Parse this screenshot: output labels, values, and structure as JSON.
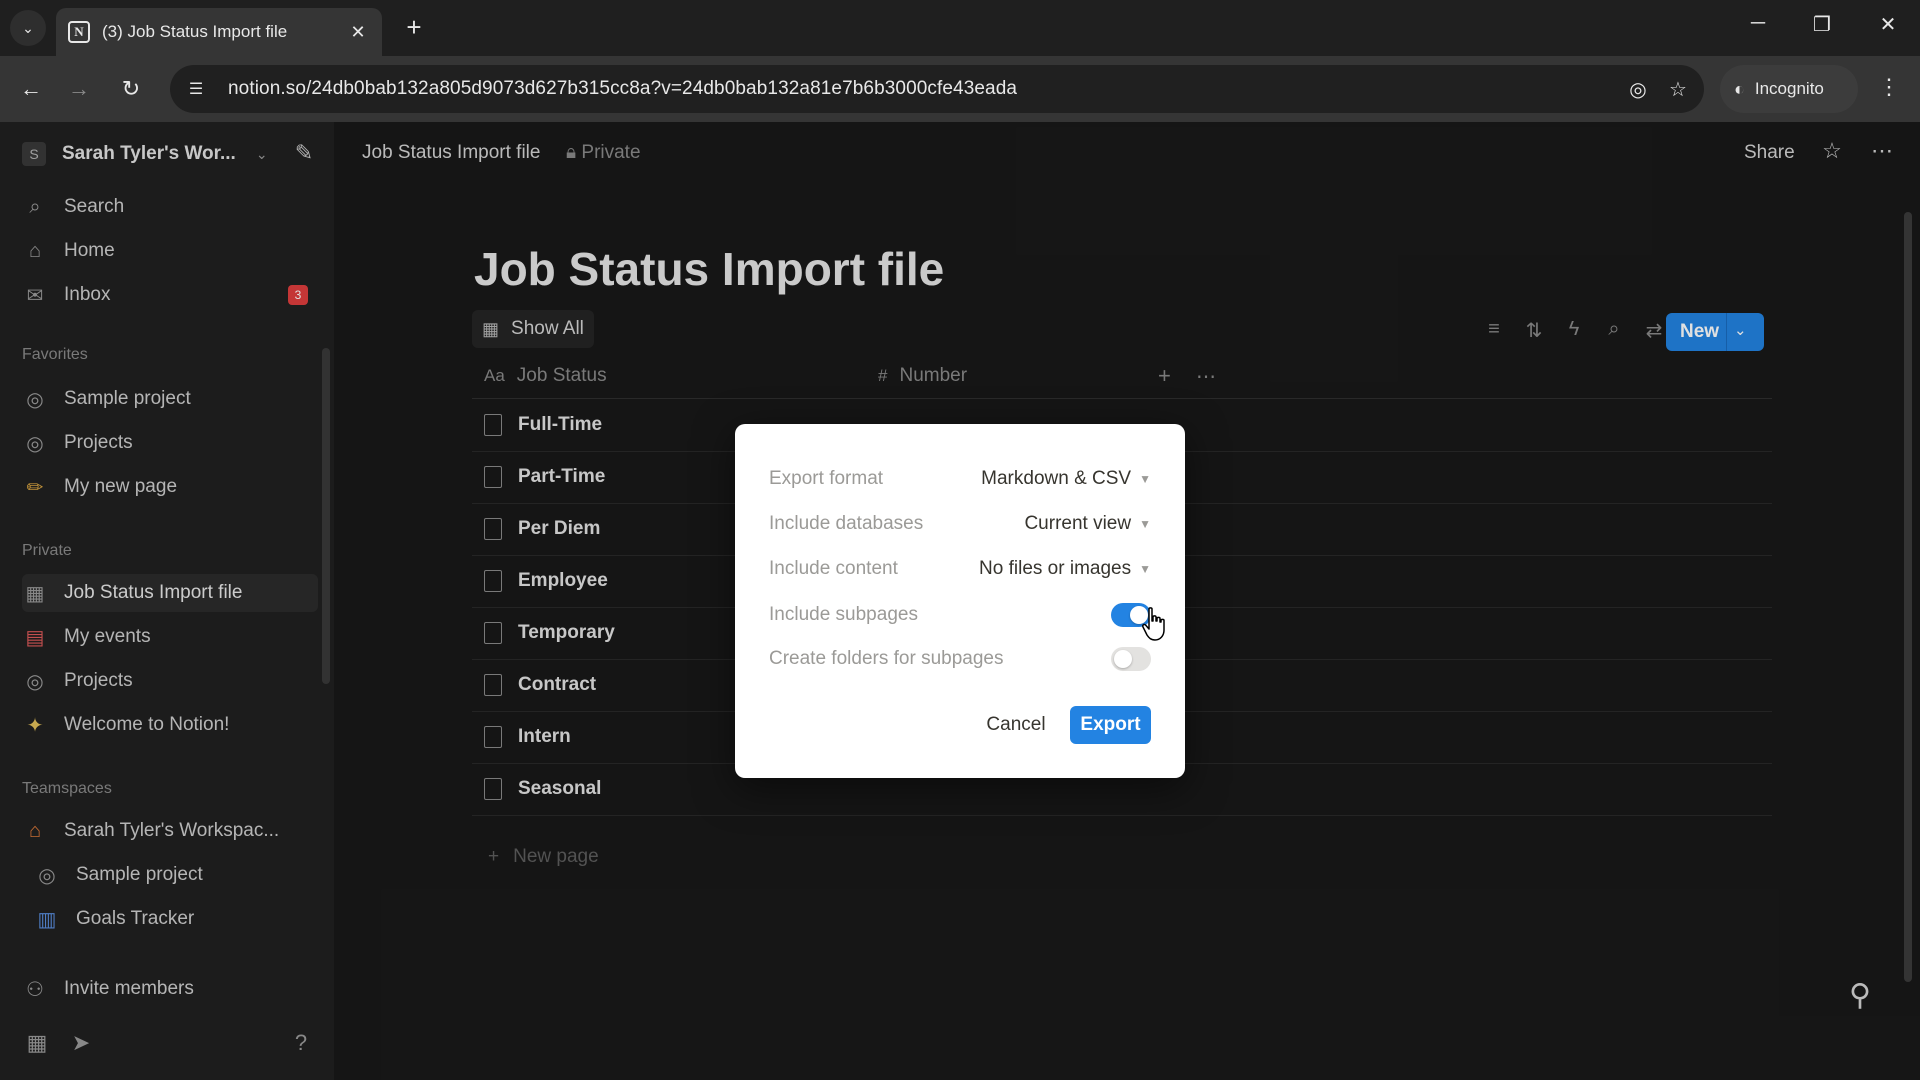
{
  "browser": {
    "tab_title": "(3) Job Status Import file",
    "tab_favicon": "N",
    "url": "notion.so/24db0bab132a805d9073d627b315cc8a?v=24db0bab132a81e7b6b3000cfe43eada",
    "profile_label": "Incognito"
  },
  "sidebar": {
    "workspace_avatar": "S",
    "workspace_name": "Sarah Tyler's Wor...",
    "top_items": [
      {
        "label": "Search",
        "icon": "search-icon"
      },
      {
        "label": "Home",
        "icon": "home-icon"
      },
      {
        "label": "Inbox",
        "icon": "inbox-icon",
        "badge": "3"
      }
    ],
    "favorites_heading": "Favorites",
    "favorites": [
      {
        "label": "Sample project",
        "icon": "target-icon"
      },
      {
        "label": "Projects",
        "icon": "target-icon"
      },
      {
        "label": "My new page",
        "icon": "pencil-icon"
      }
    ],
    "private_heading": "Private",
    "private": [
      {
        "label": "Job Status Import file",
        "icon": "table-icon"
      },
      {
        "label": "My events",
        "icon": "calendar-icon"
      },
      {
        "label": "Projects",
        "icon": "target-icon"
      },
      {
        "label": "Welcome to Notion!",
        "icon": "sparkle-icon"
      }
    ],
    "teamspaces_heading": "Teamspaces",
    "teamspaces": [
      {
        "label": "Sarah Tyler's Workspac...",
        "icon": "house-icon"
      },
      {
        "label": "Sample project",
        "icon": "target-icon"
      },
      {
        "label": "Goals Tracker",
        "icon": "chart-icon"
      }
    ],
    "invite_label": "Invite members"
  },
  "topbar": {
    "breadcrumb": "Job Status Import file",
    "privacy": "Private",
    "share_label": "Share"
  },
  "page": {
    "title": "Job Status Import file",
    "view_label": "Show All",
    "new_label": "New",
    "columns": [
      {
        "label": "Job Status",
        "icon": "Aa"
      },
      {
        "label": "Number",
        "icon": "#"
      }
    ],
    "rows": [
      "Full-Time",
      "Part-Time",
      "Per Diem",
      "Employee",
      "Temporary",
      "Contract",
      "Intern",
      "Seasonal"
    ],
    "new_page_label": "New page"
  },
  "export_dialog": {
    "format_label": "Export format",
    "format_value": "Markdown & CSV",
    "databases_label": "Include databases",
    "databases_value": "Current view",
    "content_label": "Include content",
    "content_value": "No files or images",
    "subpages_label": "Include subpages",
    "subpages_on": true,
    "folders_label": "Create folders for subpages",
    "folders_on": false,
    "cancel_label": "Cancel",
    "export_label": "Export"
  },
  "colors": {
    "accent": "#2383e2",
    "badge": "#e03e3e"
  }
}
